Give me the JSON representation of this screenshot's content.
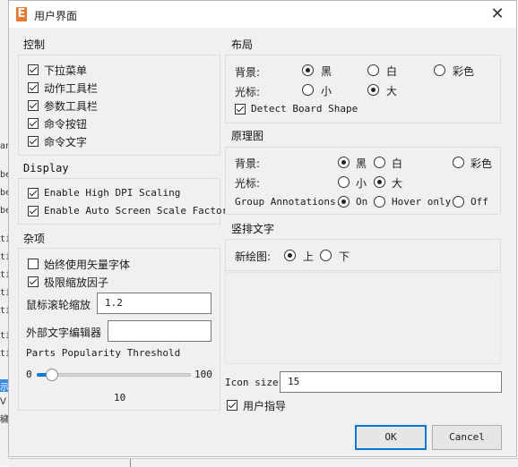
{
  "window": {
    "title": "用户界面",
    "icon_letter": "E",
    "close_symbol": "✕"
  },
  "background": {
    "left_fragments": [
      "an",
      "",
      "bes",
      "be",
      "be",
      "ti",
      "ti",
      "ti",
      "ti",
      "ti",
      "ti",
      "ti",
      "示",
      "ᐯ",
      "穢"
    ]
  },
  "control": {
    "title": "控制",
    "items": [
      {
        "label": "下拉菜单",
        "checked": true
      },
      {
        "label": "动作工具栏",
        "checked": true
      },
      {
        "label": "参数工具栏",
        "checked": true
      },
      {
        "label": "命令按钮",
        "checked": true
      },
      {
        "label": "命令文字",
        "checked": true
      }
    ]
  },
  "display": {
    "title": "Display",
    "items": [
      {
        "label": "Enable High DPI Scaling",
        "checked": true
      },
      {
        "label": "Enable Auto Screen Scale Factor",
        "checked": true
      }
    ]
  },
  "misc": {
    "title": "杂项",
    "vector_font": {
      "label": "始终使用矢量字体",
      "checked": false
    },
    "scale_factor": {
      "label": "极限缩放因子",
      "checked": true
    },
    "wheel_zoom": {
      "label": "鼠标滚轮缩放",
      "value": "1.2"
    },
    "ext_editor": {
      "label": "外部文字编辑器",
      "value": ""
    },
    "parts": {
      "label": "Parts Popularity Threshold",
      "min": "0",
      "max": "100",
      "value": "10",
      "fraction": 0.1
    }
  },
  "layout": {
    "title": "布局",
    "background_label": "背景:",
    "background_options": [
      "黑",
      "白",
      "彩色"
    ],
    "background_selected": 0,
    "cursor_label": "光标:",
    "cursor_options": [
      "小",
      "大"
    ],
    "cursor_selected": 1,
    "detect_board_shape": {
      "label": "Detect Board Shape",
      "checked": true
    }
  },
  "schematic": {
    "title": "原理图",
    "background_label": "背景:",
    "background_options": [
      "黑",
      "白",
      "彩色"
    ],
    "background_selected": 0,
    "cursor_label": "光标:",
    "cursor_options": [
      "小",
      "大"
    ],
    "cursor_selected": 1,
    "group_annotations_label": "Group Annotations:",
    "group_annotations_options": [
      "On",
      "Hover only",
      "Off"
    ],
    "group_annotations_selected": 0
  },
  "vertical_text": {
    "title": "竖排文字",
    "new_drawing_label": "新绘图:",
    "options": [
      "上",
      "下"
    ],
    "selected": 0
  },
  "icon_size": {
    "label": "Icon size",
    "value": "15"
  },
  "user_guide": {
    "label": "用户指导",
    "checked": true
  },
  "buttons": {
    "ok": "OK",
    "cancel": "Cancel"
  },
  "colors": {
    "accent": "#0078d7",
    "app_icon": "#e8772e",
    "dialog_bg": "#f0f0f0"
  }
}
